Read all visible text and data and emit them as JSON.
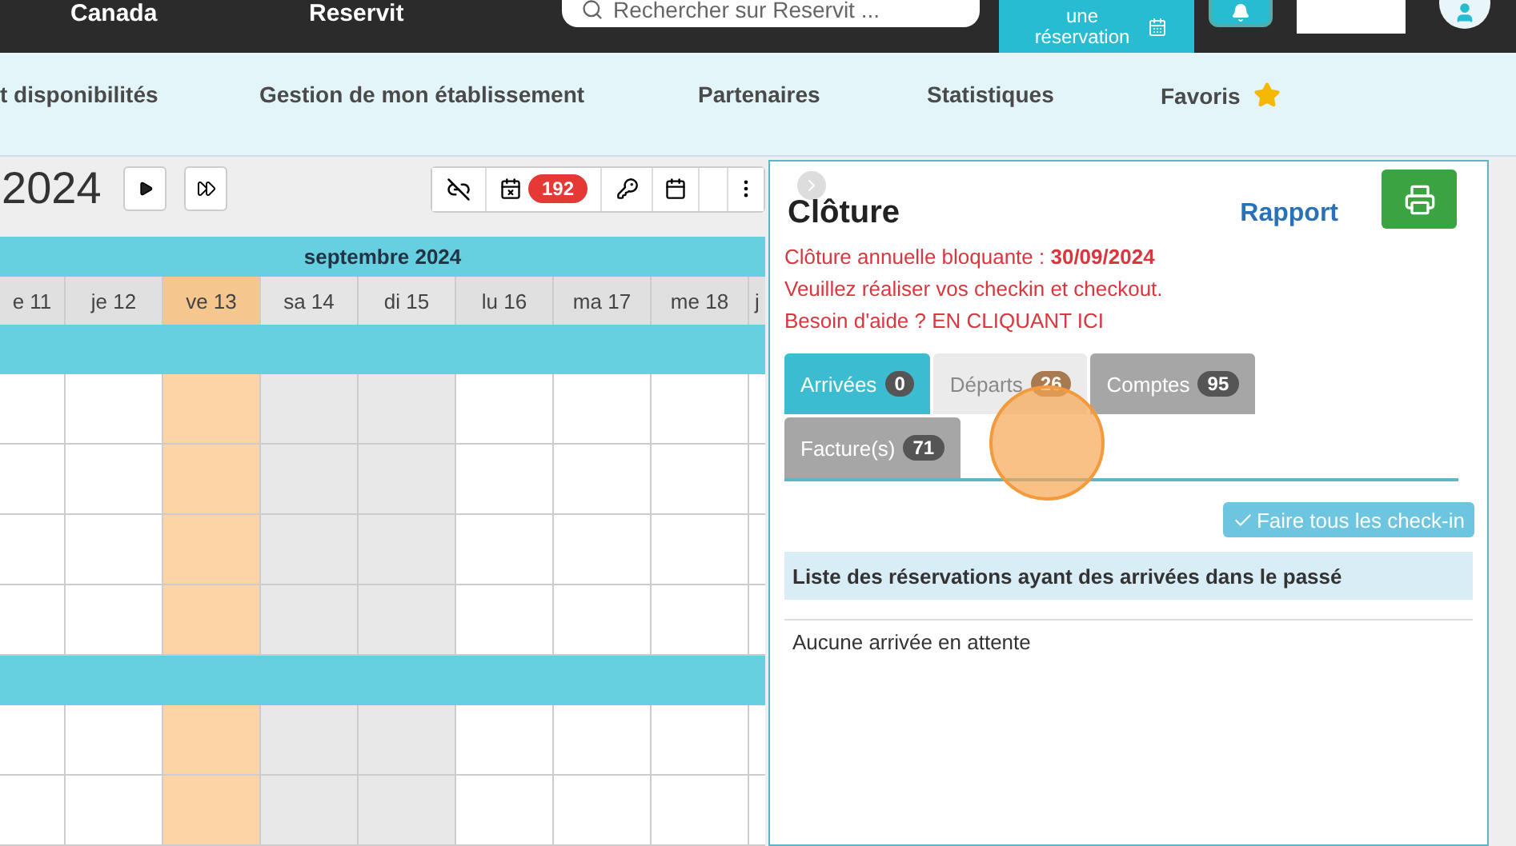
{
  "top_bar": {
    "items": [
      "Canada",
      "Reservit"
    ],
    "search": {
      "placeholder": "Rechercher sur Reservit ..."
    },
    "new_booking_button": "une réservation"
  },
  "nav": {
    "items": [
      {
        "label": "t disponibilités"
      },
      {
        "label": "Gestion de mon établissement"
      },
      {
        "label": "Partenaires"
      },
      {
        "label": "Statistiques"
      },
      {
        "label": "Favoris",
        "starred": true
      }
    ]
  },
  "calendar": {
    "year": "2024",
    "toolbar_badge": "192",
    "month": "septembre 2024",
    "days": [
      {
        "label": "e 11",
        "kind": "weekday"
      },
      {
        "label": "je 12",
        "kind": "weekday"
      },
      {
        "label": "ve 13",
        "kind": "today"
      },
      {
        "label": "sa 14",
        "kind": "weekend"
      },
      {
        "label": "di 15",
        "kind": "weekend"
      },
      {
        "label": "lu 16",
        "kind": "weekday"
      },
      {
        "label": "ma 17",
        "kind": "weekday"
      },
      {
        "label": "me 18",
        "kind": "weekday"
      },
      {
        "label": "j",
        "kind": "weekday"
      }
    ]
  },
  "panel": {
    "title": "Clôture",
    "report_link": "Rapport",
    "messages": [
      "Clôture annuelle bloquante : **30/09/2024**",
      "Veuillez réaliser vos checkin et checkout.",
      "Besoin d'aide ? EN CLIQUANT ICI"
    ],
    "tabs": [
      {
        "label": "Arrivées",
        "count": "0",
        "selected": true,
        "hovered": false
      },
      {
        "label": "Départs",
        "count": "26",
        "selected": false,
        "hovered": true
      },
      {
        "label": "Comptes",
        "count": "95",
        "selected": false,
        "hovered": false
      },
      {
        "label": "Facture(s)",
        "count": "71",
        "selected": false,
        "hovered": false
      }
    ],
    "checkin_all_button": "Faire tous les check-in",
    "list_header": "Liste des réservations ayant des arrivées dans le passé",
    "empty_text": "Aucune arrivée en attente"
  }
}
